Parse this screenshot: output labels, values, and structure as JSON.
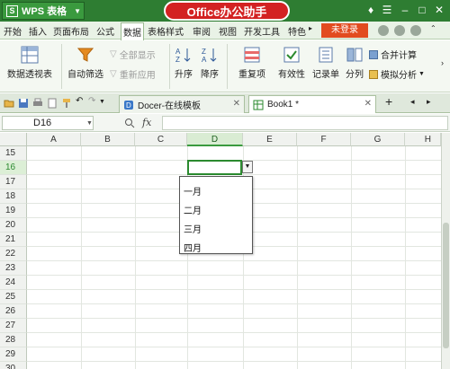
{
  "titlebar": {
    "app_title": "WPS 表格",
    "app_logo": "S",
    "banner": "Office办公助手"
  },
  "menubar": {
    "items": [
      "开始",
      "插入",
      "页面布局",
      "公式",
      "数据",
      "表格样式",
      "审阅",
      "视图",
      "开发工具",
      "特色"
    ],
    "active": "数据",
    "login": "未登录"
  },
  "ribbon": {
    "pivot": "数据透视表",
    "autofilter": "自动筛选",
    "show_all": "全部显示",
    "reapply": "重新应用",
    "sort_asc": "升序",
    "sort_desc": "降序",
    "duplicates": "重复项",
    "validity": "有效性",
    "record": "记录单",
    "split": "分列",
    "consolidate": "合并计算",
    "whatif": "模拟分析"
  },
  "tabs": {
    "docer": "Docer-在线模板",
    "book": "Book1 *",
    "add": "+"
  },
  "formula_bar": {
    "name_box": "D16",
    "fx": "fx",
    "value": ""
  },
  "sheet": {
    "columns": [
      "A",
      "B",
      "C",
      "D",
      "E",
      "F",
      "G",
      "H"
    ],
    "selected_column": "D",
    "rows": [
      "15",
      "16",
      "17",
      "18",
      "19",
      "20",
      "21",
      "22",
      "23",
      "24",
      "25",
      "26",
      "27",
      "28",
      "29",
      "30"
    ],
    "selected_row": "16"
  },
  "dropdown": {
    "options": [
      "一月",
      "二月",
      "三月",
      "四月"
    ]
  },
  "colors": {
    "title_green": "#2e7d32",
    "banner_red": "#d32222",
    "login_orange": "#e24b1f",
    "accent_green": "#2b8a2f"
  }
}
